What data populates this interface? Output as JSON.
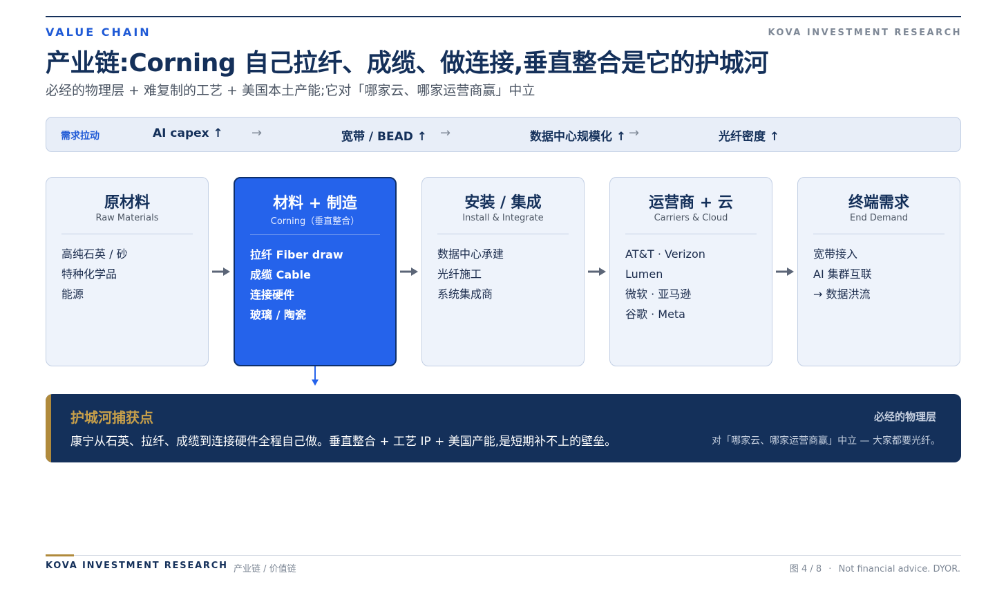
{
  "header": {
    "eyebrow": "VALUE CHAIN",
    "brand": "KOVA INVESTMENT RESEARCH",
    "title": "产业链:Corning 自己拉纤、成缆、做连接,垂直整合是它的护城河",
    "subtitle": "必经的物理层 + 难复制的工艺 + 美国本土产能;它对「哪家云、哪家运营商赢」中立"
  },
  "demand": {
    "label": "需求拉动",
    "items": [
      "AI capex ↑",
      "宽带 / BEAD ↑",
      "数据中心规模化 ↑",
      "光纤密度 ↑"
    ],
    "arrow": "→"
  },
  "stages": [
    {
      "title": "原材料",
      "subtitle": "Raw Materials",
      "items": [
        "高纯石英 / 砂",
        "特种化学品",
        "能源"
      ]
    },
    {
      "title": "材料 + 制造",
      "subtitle": "Corning（垂直整合）",
      "items": [
        "拉纤 Fiber draw",
        "成缆 Cable",
        "连接硬件",
        "玻璃 / 陶瓷"
      ],
      "highlight": true
    },
    {
      "title": "安装 / 集成",
      "subtitle": "Install & Integrate",
      "items": [
        "数据中心承建",
        "光纤施工",
        "系统集成商"
      ]
    },
    {
      "title": "运营商 + 云",
      "subtitle": "Carriers & Cloud",
      "items": [
        "AT&T · Verizon",
        "Lumen",
        "微软 · 亚马逊",
        "谷歌 · Meta"
      ]
    },
    {
      "title": "终端需求",
      "subtitle": "End Demand",
      "items": [
        "宽带接入",
        "AI 集群互联",
        "→ 数据洪流"
      ]
    }
  ],
  "moat": {
    "heading": "护城河捕获点",
    "body": "康宁从石英、拉纤、成缆到连接硬件全程自己做。垂直整合 + 工艺 IP + 美国产能,是短期补不上的壁垒。",
    "right_title": "必经的物理层",
    "right_text": "对「哪家云、哪家运营商赢」中立 — 大家都要光纤。"
  },
  "footer": {
    "brand": "KOVA INVESTMENT RESEARCH",
    "section": "产业链 / 价值链",
    "page": "图 4 / 8",
    "separator": "·",
    "disclaimer": "Not financial advice. DYOR."
  },
  "colors": {
    "navy": "#14305a",
    "accent_blue": "#2563eb",
    "gold": "#b08a3c",
    "card_bg": "#eef3fb"
  }
}
